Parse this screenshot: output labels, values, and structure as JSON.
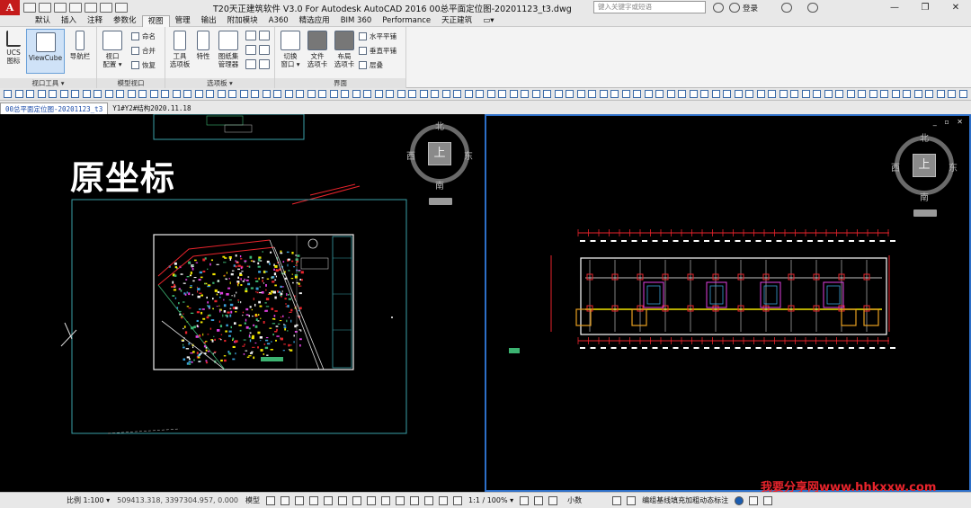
{
  "titlebar": {
    "logo": "A",
    "title": "T20天正建筑软件 V3.0 For Autodesk AutoCAD 2016    00总平面定位图-20201123_t3.dwg",
    "search_placeholder": "键入关键字或短语",
    "login_label": "登录",
    "minimize": "—",
    "restore": "❐",
    "close": "✕"
  },
  "menu": {
    "tabs": [
      "默认",
      "插入",
      "注释",
      "参数化",
      "视图",
      "管理",
      "输出",
      "附加模块",
      "A360",
      "精选应用",
      "BIM 360",
      "Performance",
      "天正建筑"
    ],
    "active_index": 4
  },
  "ribbon": {
    "panels": [
      {
        "title": "视口工具 ▾"
      },
      {
        "title": "模型视口"
      },
      {
        "title": "选项板 ▾"
      },
      {
        "title": "界面"
      }
    ],
    "buttons": {
      "ucs": "UCS\n图标",
      "viewcube": "ViewCube",
      "navbar": "导航栏",
      "viewport_config": "视口\n配置 ▾",
      "name": "命名",
      "merge": "合并",
      "restore": "恢复",
      "tool_palette": "工具\n选项板",
      "properties": "特性",
      "sheet_set": "图纸集\n管理器",
      "switch_window": "切换\n窗口 ▾",
      "file_tabs": "文件\n选项卡",
      "layout_tabs": "布局\n选项卡",
      "tile_h": "水平平铺",
      "tile_v": "垂直平铺",
      "cascade": "层叠"
    }
  },
  "doctabs": {
    "tabs": [
      "00总平面定位图-20201123_t3",
      "Y1#Y2#结构2020.11.18"
    ],
    "active_index": 0
  },
  "left_viewport": {
    "label": "原坐标",
    "compass": {
      "n": "北",
      "s": "南",
      "e": "东",
      "w": "西",
      "top": "上"
    }
  },
  "right_viewport": {
    "compass": {
      "n": "北",
      "s": "南",
      "e": "东",
      "w": "西",
      "top": "上"
    }
  },
  "status": {
    "scale": "比例 1:100 ▾",
    "coords": "509413.318, 3397304.957, 0.000",
    "model": "模型",
    "zoom": "1:1 / 100% ▾",
    "decimal": "小数",
    "annotation": "编组基线填充加粗动态标注"
  },
  "watermark": "我要分享网www.hhkxxw.com",
  "colors": {
    "drawing_bg": "#000000",
    "active_border": "#2d6fc8",
    "cad_red": "#e8242c",
    "cad_yellow": "#f2e600"
  }
}
